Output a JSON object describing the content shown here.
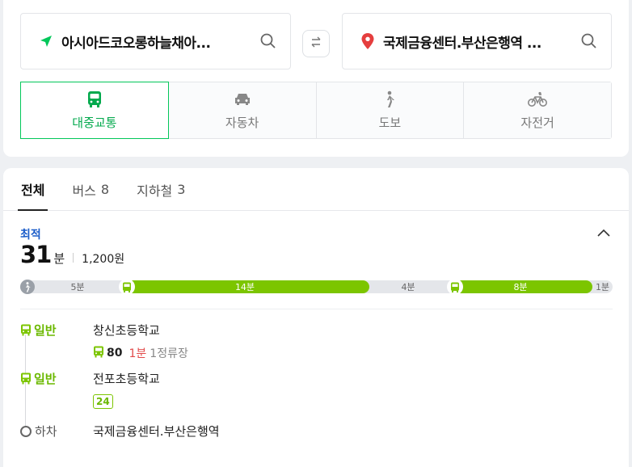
{
  "search": {
    "start": "아시아드코오롱하늘채아...",
    "end": "국제금융센터.부산은행역 ..."
  },
  "modes": [
    {
      "label": "대중교통",
      "icon": "bus-icon"
    },
    {
      "label": "자동차",
      "icon": "car-icon"
    },
    {
      "label": "도보",
      "icon": "walk-icon"
    },
    {
      "label": "자전거",
      "icon": "bike-icon"
    }
  ],
  "tabs": [
    {
      "label": "전체",
      "count": ""
    },
    {
      "label": "버스",
      "count": "8"
    },
    {
      "label": "지하철",
      "count": "3"
    }
  ],
  "route": {
    "badge": "최적",
    "minutes": "31",
    "unit": "분",
    "fare": "1,200원",
    "segments": [
      {
        "type": "walk",
        "label": "5분"
      },
      {
        "type": "bus",
        "label": "14분"
      },
      {
        "type": "walk",
        "label": "4분"
      },
      {
        "type": "bus",
        "label": "8분"
      },
      {
        "type": "walk",
        "label": "1분"
      }
    ],
    "steps": [
      {
        "tag": "일반",
        "place": "창신초등학교",
        "bus_no": "80",
        "wait": "1분",
        "stops": "1정류장"
      },
      {
        "tag": "일반",
        "place": "전포초등학교",
        "bus_no": "24"
      },
      {
        "tag": "하차",
        "place": "국제금융센터.부산은행역"
      }
    ]
  },
  "colors": {
    "accent": "#03c75a",
    "bus": "#7cc500",
    "best": "#1a5cc9",
    "wait": "#e24a4a"
  }
}
